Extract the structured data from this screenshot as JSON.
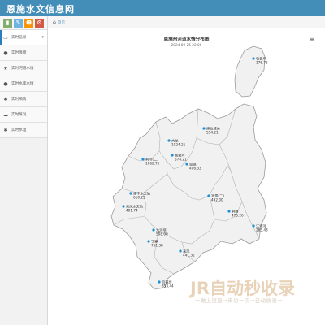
{
  "app": {
    "title": "恩施水文信息网"
  },
  "sidebar": {
    "shortcuts": [
      {
        "icon": "chart-icon"
      },
      {
        "icon": "pencil-icon"
      },
      {
        "icon": "users-icon"
      },
      {
        "icon": "cogs-icon"
      }
    ],
    "items": [
      {
        "label": "实时信息",
        "icon": "desktop-icon"
      },
      {
        "label": "实时降雨",
        "icon": "raindrop-icon"
      },
      {
        "label": "实时河道水情",
        "icon": "star-icon"
      },
      {
        "label": "实时水库水情",
        "icon": "raindrop-icon"
      },
      {
        "label": "实时墒情",
        "icon": "asterisk-icon"
      },
      {
        "label": "实时蒸发",
        "icon": "cloud-icon"
      },
      {
        "label": "实时水温",
        "icon": "asterisk-icon"
      }
    ]
  },
  "breadcrumb": {
    "home": "首页"
  },
  "map": {
    "title": "恩施州河道水情分布图",
    "subtitle": "2024-09-25 22:00",
    "menu_icon": "hamburger-icon",
    "stations": [
      {
        "name": "石板坪",
        "value": "176.75"
      },
      {
        "name": "建始城关",
        "value": "554.21"
      },
      {
        "name": "大龙",
        "value": "1024.21"
      },
      {
        "name": "利川(二)",
        "value": "1062.75"
      },
      {
        "name": "高坡坪",
        "value": "574.21"
      },
      {
        "name": "恩施",
        "value": "406.33"
      },
      {
        "name": "宣恩(二)",
        "value": "492.00"
      },
      {
        "name": "咸丰水文站",
        "value": "610.25"
      },
      {
        "name": "鹤峰",
        "value": "475.26"
      },
      {
        "name": "来凤水文站",
        "value": "401.74"
      },
      {
        "name": "江坪河",
        "value": "285.48"
      },
      {
        "name": "大河坝",
        "value": "508.00"
      },
      {
        "name": "丁寨",
        "value": "751.38"
      },
      {
        "name": "来凤",
        "value": "441.32"
      },
      {
        "name": "百福司",
        "value": "353.44"
      }
    ],
    "point_color": "#1f8fd6"
  },
  "watermark": {
    "logo": "JR自动秒收录",
    "tagline": "一做上链接→来访一次→自动收录一"
  }
}
